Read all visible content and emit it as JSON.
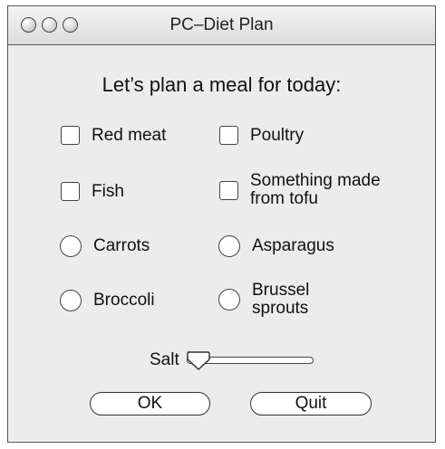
{
  "window": {
    "title": "PC–Diet Plan"
  },
  "heading": "Let’s plan a meal for today:",
  "options": {
    "red_meat": {
      "label": "Red meat",
      "checked": false
    },
    "poultry": {
      "label": "Poultry",
      "checked": false
    },
    "fish": {
      "label": "Fish",
      "checked": false
    },
    "tofu": {
      "label": "Something made\nfrom tofu",
      "checked": false
    },
    "carrots": {
      "label": "Carrots",
      "selected": false
    },
    "asparagus": {
      "label": "Asparagus",
      "selected": false
    },
    "broccoli": {
      "label": "Broccoli",
      "selected": false
    },
    "brussel": {
      "label": "Brussel\nsprouts",
      "selected": false
    }
  },
  "salt": {
    "label": "Salt",
    "level": 0
  },
  "buttons": {
    "ok": "OK",
    "quit": "Quit"
  }
}
